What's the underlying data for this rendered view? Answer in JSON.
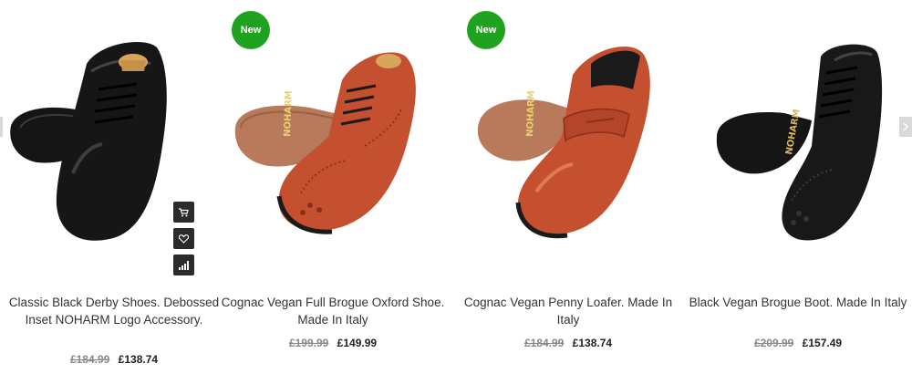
{
  "products": [
    {
      "title": "Classic Black Derby Shoes. Debossed Inset NOHARM Logo Accessory.",
      "old_price": "£184.99",
      "price": "£138.74",
      "badge": "",
      "color": "black"
    },
    {
      "title": "Cognac Vegan Full Brogue Oxford Shoe. Made In Italy",
      "old_price": "£199.99",
      "price": "£149.99",
      "badge": "New",
      "color": "cognac"
    },
    {
      "title": "Cognac Vegan Penny Loafer. Made In Italy",
      "old_price": "£184.99",
      "price": "£138.74",
      "badge": "New",
      "color": "cognac"
    },
    {
      "title": "Black Vegan Brogue Boot. Made In Italy",
      "old_price": "£209.99",
      "price": "£157.49",
      "badge": "",
      "color": "black"
    }
  ],
  "sole_logo": "NOHARM",
  "actions": [
    "cart-icon",
    "heart-icon",
    "compare-icon"
  ],
  "colors": {
    "badge": "#1fa21f",
    "cognac": "#c4502f",
    "black": "#1a1a1a"
  }
}
